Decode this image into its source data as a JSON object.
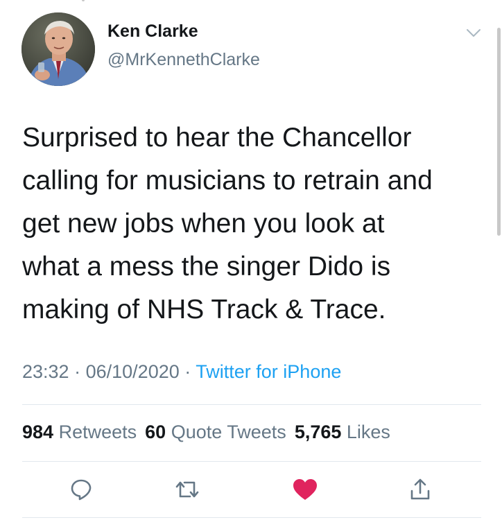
{
  "tweet": {
    "author": {
      "display_name": "Ken Clarke",
      "handle": "@MrKennethClarke"
    },
    "text": "Surprised to hear the Chancellor\ncalling for musicians to retrain and\nget new jobs when you look at\nwhat a mess the singer Dido is\nmaking of NHS Track & Trace.",
    "time": "23:32",
    "date": "06/10/2020",
    "separator": "·",
    "source": "Twitter for iPhone",
    "stats": {
      "retweets_count": "984",
      "retweets_label": "Retweets",
      "quote_tweets_count": "60",
      "quote_tweets_label": "Quote Tweets",
      "likes_count": "5,765",
      "likes_label": "Likes"
    },
    "actions": [
      {
        "name": "reply",
        "icon": "reply-icon"
      },
      {
        "name": "retweet",
        "icon": "retweet-icon"
      },
      {
        "name": "like",
        "icon": "heart-icon",
        "active": true
      },
      {
        "name": "share",
        "icon": "share-icon"
      }
    ],
    "colors": {
      "link": "#1da1f2",
      "secondary": "#657786",
      "like_active": "#e0245e"
    }
  }
}
